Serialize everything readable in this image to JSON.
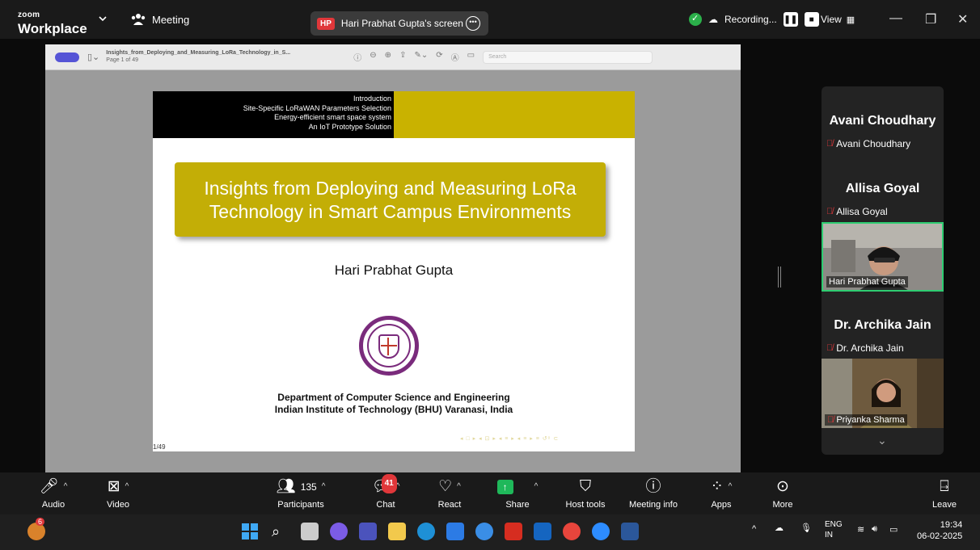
{
  "topbar": {
    "logo_small": "zoom",
    "logo_main": "Workplace",
    "meeting_label": "Meeting",
    "sharer_initials": "HP",
    "sharer_label": "Hari Prabhat Gupta's screen",
    "recording_label": "Recording...",
    "view_label": "View"
  },
  "pdf": {
    "filename": "Insights_from_Deploying_and_Measuring_LoRa_Technology_in_S...",
    "page_info": "Page 1 of 49",
    "search_placeholder": "Search"
  },
  "slide": {
    "header_lines": [
      "Introduction",
      "Site-Specific LoRaWAN Parameters Selection",
      "Energy-efficient smart space system",
      "An IoT Prototype Solution"
    ],
    "title_line1": "Insights from Deploying and Measuring LoRa",
    "title_line2": "Technology in Smart Campus Environments",
    "author": "Hari Prabhat Gupta",
    "dept_line1": "Department of Computer Science and Engineering",
    "dept_line2": "Indian Institute of Technology (BHU) Varanasi, India",
    "page": "1/49",
    "nav_glyphs": "◂ □ ▸ ◂ ⊡ ▸ ◂ ≡ ▸ ◂ ≡ ▸  ≡  ↺ᵒ ⊂"
  },
  "participants": [
    {
      "name": "Avani Choudhary",
      "sub": "Avani Choudhary"
    },
    {
      "name": "Allisa Goyal",
      "sub": "Allisa Goyal"
    },
    {
      "video_label": "Hari Prabhat Gupta"
    },
    {
      "name": "Dr. Archika Jain",
      "sub": "Dr. Archika Jain"
    },
    {
      "video_label": "Priyanka Sharma"
    }
  ],
  "toolbar": {
    "audio": "Audio",
    "video": "Video",
    "participants": "Participants",
    "participants_count": "135",
    "chat": "Chat",
    "chat_badge": "41",
    "react": "React",
    "share": "Share",
    "host_tools": "Host tools",
    "meeting_info": "Meeting info",
    "apps": "Apps",
    "more": "More",
    "leave": "Leave"
  },
  "taskbar": {
    "notification_count": "6",
    "lang_line1": "ENG",
    "lang_line2": "IN",
    "time": "19:34",
    "date": "06-02-2025"
  }
}
